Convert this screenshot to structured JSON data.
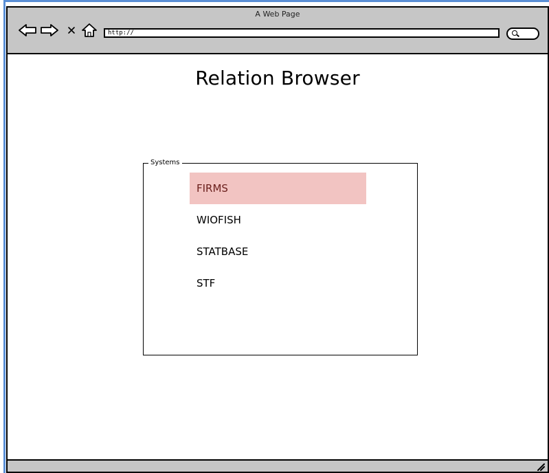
{
  "window": {
    "title": "A Web Page"
  },
  "toolbar": {
    "back_icon": "back-arrow-icon",
    "forward_icon": "forward-arrow-icon",
    "stop_icon": "close-icon",
    "home_icon": "home-icon",
    "url_value": "http://",
    "search_icon": "search-icon"
  },
  "page": {
    "title": "Relation Browser"
  },
  "systems": {
    "legend": "Systems",
    "items": [
      {
        "label": "FIRMS",
        "selected": true
      },
      {
        "label": "WIOFISH",
        "selected": false
      },
      {
        "label": "STATBASE",
        "selected": false
      },
      {
        "label": "STF",
        "selected": false
      }
    ]
  },
  "colors": {
    "chrome": "#c6c6c6",
    "selection": "#f2c4c2",
    "selection_text": "#6a1f1c",
    "frame_accent": "#5a8fd6"
  },
  "statusbar": {
    "grip_icon": "resize-grip-icon"
  }
}
